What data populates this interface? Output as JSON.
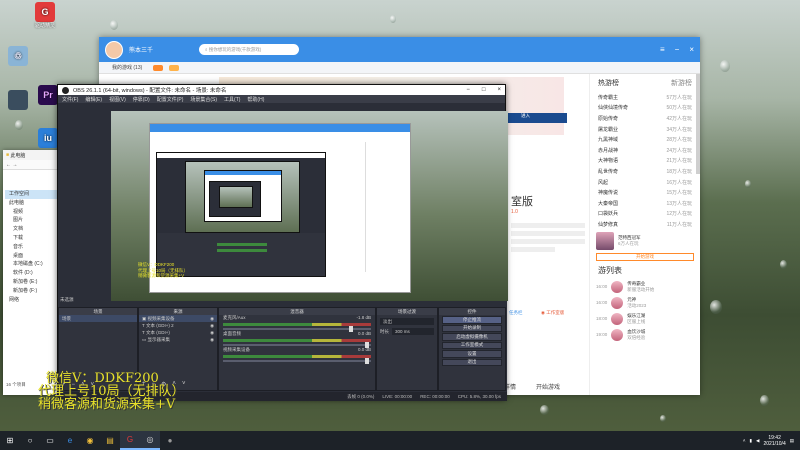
{
  "desktop": {
    "icons": [
      {
        "label": "驱动精灵",
        "glyph": "G",
        "color": "#e23a3a"
      },
      {
        "label": "",
        "glyph": "♲",
        "color": "#8ab4d6"
      },
      {
        "label": "",
        "glyph": "Pr",
        "color": "#2a0b4d"
      },
      {
        "label": "",
        "glyph": "iu",
        "color": "#2b7fd9"
      }
    ]
  },
  "explorer": {
    "title": "此电脑",
    "items": [
      "工作空间",
      "此电脑",
      "视频",
      "图片",
      "文档",
      "下载",
      "音乐",
      "桌面",
      "本地磁盘 (C:)",
      "软件 (D:)",
      "新加卷 (E:)",
      "新加卷 (F:)",
      "网络"
    ],
    "status": "16 个项目"
  },
  "game_window": {
    "user": "熊本三千",
    "search_placeholder": "搜你想玩的游戏(千款游戏)",
    "tabs": [
      "我的游戏 (13)"
    ],
    "right_title": "热游榜",
    "right_tab": "新游榜",
    "ranking": [
      {
        "name": "传奇霸主",
        "count": "57万人在玩"
      },
      {
        "name": "仙侠仙境传奇",
        "count": "50万人在玩"
      },
      {
        "name": "原始传奇",
        "count": "42万人在玩"
      },
      {
        "name": "屠龙霸业",
        "count": "34万人在玩"
      },
      {
        "name": "九黑神域",
        "count": "28万人在玩"
      },
      {
        "name": "赤月战神",
        "count": "24万人在玩"
      },
      {
        "name": "大神物语",
        "count": "21万人在玩"
      },
      {
        "name": "乱世传奇",
        "count": "18万人在玩"
      },
      {
        "name": "风起",
        "count": "16万人在玩"
      },
      {
        "name": "神魔传说",
        "count": "15万人在玩"
      },
      {
        "name": "大秦帝国",
        "count": "13万人在玩"
      },
      {
        "name": "口袋妖兵",
        "count": "12万人在玩"
      },
      {
        "name": "仙梦修真",
        "count": "11万人在玩"
      }
    ],
    "featured": {
      "name": "范特西冠军",
      "count": "6万人在玩",
      "action": "开始游戏"
    },
    "list_title": "游列表",
    "timeline": [
      {
        "time": "16:00",
        "name": "传奇霸业",
        "desc": "新服活动开始"
      },
      {
        "time": "16:00",
        "name": "元神",
        "desc": "活动2023"
      },
      {
        "time": "18:00",
        "name": "娱乐江湖",
        "desc": "区服上线"
      },
      {
        "time": "19:00",
        "name": "血饮沙城",
        "desc": "双倍经验"
      }
    ],
    "mid_title": "室版",
    "mid_link": "进入",
    "mid_pill_a": "任务栏",
    "mid_pill_b": "工作室版",
    "bottom_left": "详情",
    "bottom_right": "开始游戏"
  },
  "obs": {
    "title": "OBS 26.1.1 (64-bit, windows) - 配置文件: 未命名 - 场景: 未命名",
    "menu": [
      "文件(F)",
      "编辑(E)",
      "视图(V)",
      "停靠(D)",
      "配置文件(P)",
      "场景集合(S)",
      "工具(T)",
      "帮助(H)"
    ],
    "scene_label": "未选源",
    "panels": {
      "scenes": "场景",
      "sources": "来源",
      "mixer": "混音器",
      "transitions": "场景过渡",
      "controls": "控件"
    },
    "scene_items": [
      "场景"
    ],
    "source_items": [
      "视频采集设备",
      "文本 (GDI+) 2",
      "文本 (GDI+)",
      "显示器采集"
    ],
    "mixer_channels": [
      {
        "name": "麦克风/Aux",
        "db": "-1.8 dB"
      },
      {
        "name": "桌面音频",
        "db": "0.0 dB"
      },
      {
        "name": "视频采集设备",
        "db": "0.0 dB"
      }
    ],
    "transition_type": "淡出",
    "transition_duration_label": "时长",
    "transition_duration": "300 ms",
    "controls": [
      "停止推流",
      "开始录制",
      "启动虚拟摄像机",
      "工作室模式",
      "设置",
      "退出"
    ],
    "status": {
      "drop": "丢帧 0 (0.0%)",
      "live": "LIVE: 00:00:00",
      "rec": "REC: 00:00:00",
      "cpu": "CPU: 5.8%, 30.00 fps"
    }
  },
  "watermark": {
    "line1": "微信V：DDKF200",
    "line2": "代理上号10局（无排队）",
    "line3": "稍微客源和货源采集+V"
  },
  "taskbar": {
    "clock_time": "19:42",
    "clock_date": "2021/10/4",
    "items": [
      "⊞",
      "○",
      "▭",
      "e",
      "◉",
      "▤",
      "G",
      "◎",
      "●"
    ]
  }
}
